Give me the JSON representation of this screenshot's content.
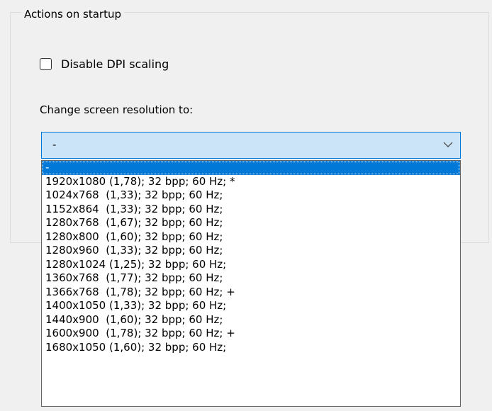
{
  "group": {
    "title": "Actions on startup"
  },
  "dpi_checkbox": {
    "label": "Disable DPI scaling",
    "checked": false
  },
  "resolution": {
    "label": "Change screen resolution to:",
    "selected_value": "-",
    "options": [
      "-",
      "1920x1080 (1,78); 32 bpp; 60 Hz; *",
      "1024x768  (1,33); 32 bpp; 60 Hz;",
      "1152x864  (1,33); 32 bpp; 60 Hz;",
      "1280x768  (1,67); 32 bpp; 60 Hz;",
      "1280x800  (1,60); 32 bpp; 60 Hz;",
      "1280x960  (1,33); 32 bpp; 60 Hz;",
      "1280x1024 (1,25); 32 bpp; 60 Hz;",
      "1360x768  (1,77); 32 bpp; 60 Hz;",
      "1366x768  (1,78); 32 bpp; 60 Hz; +",
      "1400x1050 (1,33); 32 bpp; 60 Hz;",
      "1440x900  (1,60); 32 bpp; 60 Hz;",
      "1600x900  (1,78); 32 bpp; 60 Hz; +",
      "1680x1050 (1,60); 32 bpp; 60 Hz;"
    ]
  },
  "colors": {
    "accent": "#0078d7",
    "combo_bg": "#cce4f7",
    "window_bg": "#f0f0f0"
  }
}
